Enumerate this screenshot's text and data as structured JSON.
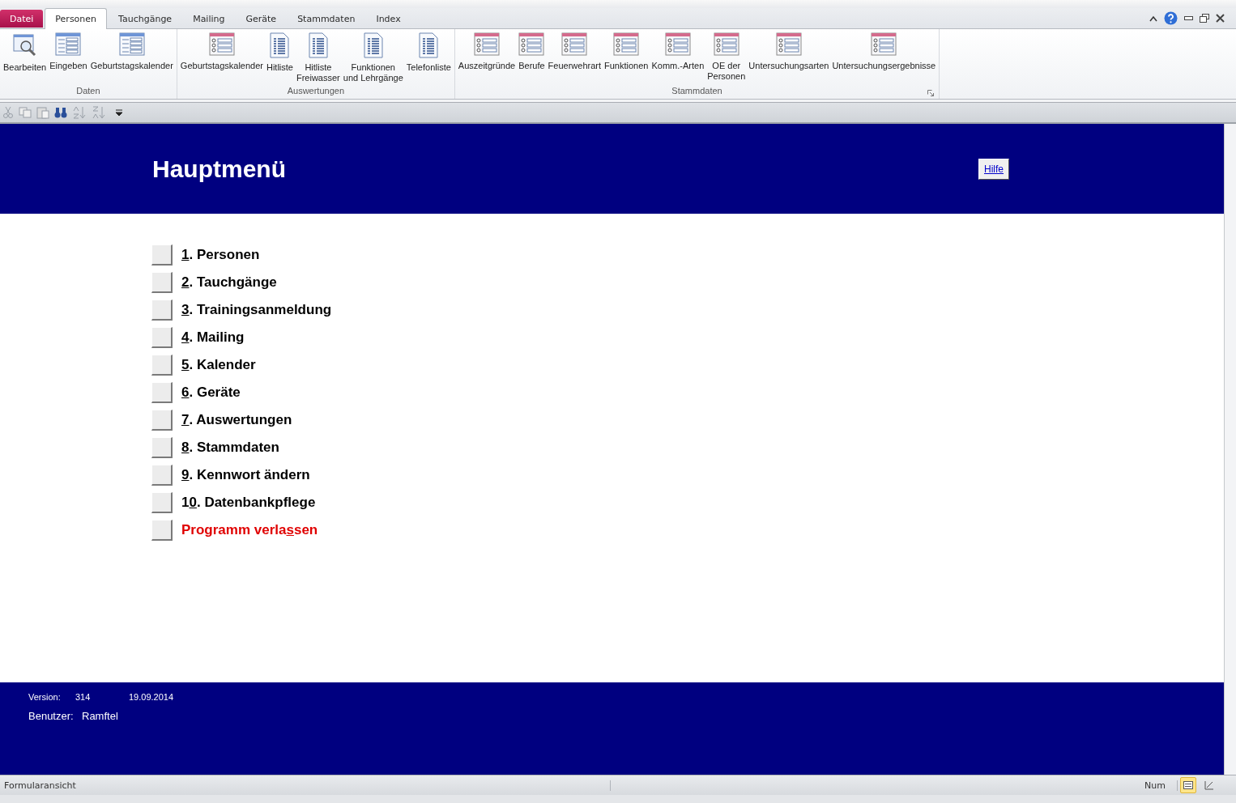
{
  "tabs": [
    {
      "label": "Datei",
      "kind": "file",
      "selected": false
    },
    {
      "label": "Personen",
      "kind": "tab",
      "selected": true
    },
    {
      "label": "Tauchgänge",
      "kind": "tab",
      "selected": false
    },
    {
      "label": "Mailing",
      "kind": "tab",
      "selected": false
    },
    {
      "label": "Geräte",
      "kind": "tab",
      "selected": false
    },
    {
      "label": "Stammdaten",
      "kind": "tab",
      "selected": false
    },
    {
      "label": "Index",
      "kind": "tab",
      "selected": false
    }
  ],
  "ribbon_groups": [
    {
      "label": "Daten",
      "launcher": false,
      "buttons": [
        {
          "label": "Bearbeiten",
          "kind": "search"
        },
        {
          "label": "Eingeben",
          "kind": "form"
        },
        {
          "label": "Geburtstagskalender",
          "kind": "form"
        }
      ]
    },
    {
      "label": "Auswertungen",
      "launcher": false,
      "buttons": [
        {
          "label": "Geburtstagskalender",
          "kind": "table"
        },
        {
          "label": "Hitliste",
          "kind": "report"
        },
        {
          "label": "Hitliste\nFreiwasser",
          "kind": "report"
        },
        {
          "label": "Funktionen\nund Lehrgänge",
          "kind": "report"
        },
        {
          "label": "Telefonliste",
          "kind": "report"
        }
      ]
    },
    {
      "label": "Stammdaten",
      "launcher": true,
      "buttons": [
        {
          "label": "Auszeitgründe",
          "kind": "table"
        },
        {
          "label": "Berufe",
          "kind": "table"
        },
        {
          "label": "Feuerwehrart",
          "kind": "table"
        },
        {
          "label": "Funktionen",
          "kind": "table"
        },
        {
          "label": "Komm.-Arten",
          "kind": "table"
        },
        {
          "label": "OE der\nPersonen",
          "kind": "table"
        },
        {
          "label": "Untersuchungsarten",
          "kind": "table"
        },
        {
          "label": "Untersuchungsergebnisse",
          "kind": "table"
        }
      ]
    }
  ],
  "quick_toolbar": [
    {
      "kind": "cut",
      "disabled": true
    },
    {
      "kind": "copy",
      "disabled": true
    },
    {
      "kind": "paste",
      "disabled": true
    },
    {
      "kind": "find",
      "disabled": false
    },
    {
      "kind": "sort-asc",
      "disabled": true
    },
    {
      "kind": "sort-desc",
      "disabled": true
    },
    {
      "kind": "dropdown",
      "disabled": false
    }
  ],
  "header": {
    "title": "Hauptmenü",
    "help_link": "Hilfe"
  },
  "menu": [
    {
      "key": "1",
      "suffix": ". Personen",
      "kind": "normal"
    },
    {
      "key": "2",
      "suffix": ". Tauchgänge",
      "kind": "normal"
    },
    {
      "key": "3",
      "suffix": ". Trainingsanmeldung",
      "kind": "normal"
    },
    {
      "key": "4",
      "suffix": ". Mailing",
      "kind": "normal"
    },
    {
      "key": "5",
      "suffix": ". Kalender",
      "kind": "normal"
    },
    {
      "key": "6",
      "suffix": ". Geräte",
      "kind": "normal"
    },
    {
      "key": "7",
      "suffix": ". Auswertungen",
      "kind": "normal"
    },
    {
      "key": "8",
      "suffix": ". Stammdaten",
      "kind": "normal"
    },
    {
      "key": "9",
      "suffix": ". Kennwort ändern",
      "kind": "normal"
    },
    {
      "prefix": "1",
      "key": "0",
      "suffix": ". Datenbankpflege",
      "kind": "normal"
    },
    {
      "prefix": "Programm verla",
      "key": "s",
      "suffix": "sen",
      "kind": "exit"
    }
  ],
  "footer": {
    "version_label": "Version:",
    "version": "314",
    "date": "19.09.2014",
    "user_label": "Benutzer:",
    "user": "Ramftel"
  },
  "status_bar": {
    "text": "Formularansicht",
    "num": "Num",
    "views": [
      {
        "kind": "form",
        "selected": true
      },
      {
        "kind": "design",
        "selected": false
      }
    ]
  }
}
